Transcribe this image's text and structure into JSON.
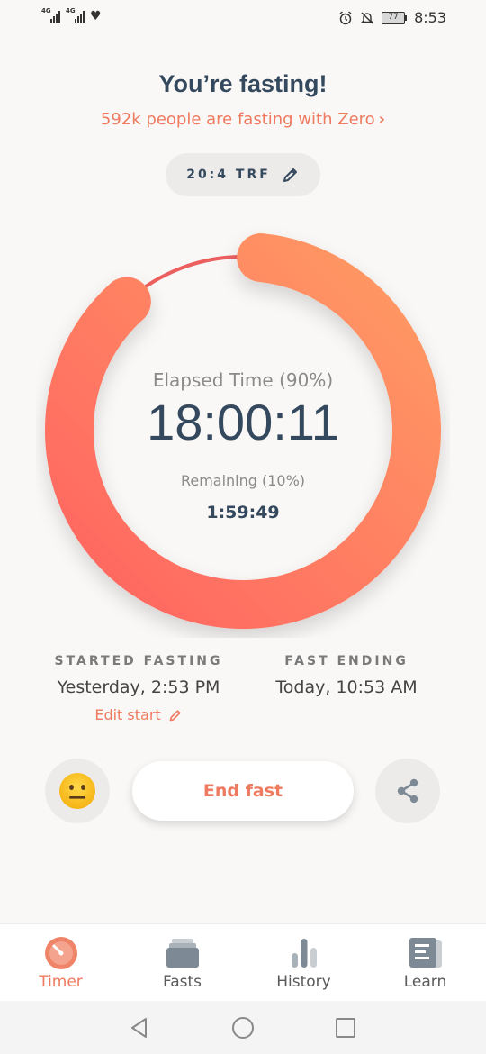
{
  "status": {
    "network1": "4G",
    "network2": "4G",
    "battery": "77",
    "time": "8:53"
  },
  "header": {
    "title": "You’re fasting!",
    "subtitle": "592k people are fasting with Zero",
    "subtitle_chevron": "›"
  },
  "plan": {
    "label": "20:4 TRF",
    "icon": "pencil-icon"
  },
  "timer": {
    "progress": 0.9,
    "elapsed_label": "Elapsed Time (90%)",
    "elapsed_value": "18:00:11",
    "remaining_label": "Remaining (10%)",
    "remaining_value": "1:59:49",
    "colors": {
      "start": "#ff6461",
      "end": "#ff9b64",
      "track": "#ec5f5f"
    }
  },
  "schedule": {
    "started_heading": "STARTED FASTING",
    "started_value": "Yesterday, 2:53 PM",
    "edit_start": "Edit start",
    "ending_heading": "FAST ENDING",
    "ending_value": "Today, 10:53 AM"
  },
  "actions": {
    "mood_icon": "neutral-face-icon",
    "end_fast": "End fast",
    "share_icon": "share-icon"
  },
  "tabs": [
    {
      "label": "Timer",
      "icon": "timer-icon",
      "active": true
    },
    {
      "label": "Fasts",
      "icon": "fasts-icon",
      "active": false
    },
    {
      "label": "History",
      "icon": "history-icon",
      "active": false
    },
    {
      "label": "Learn",
      "icon": "learn-icon",
      "active": false
    }
  ],
  "colors": {
    "accent": "#ee7a5f",
    "text": "#34495e",
    "background": "#faf8f6"
  }
}
